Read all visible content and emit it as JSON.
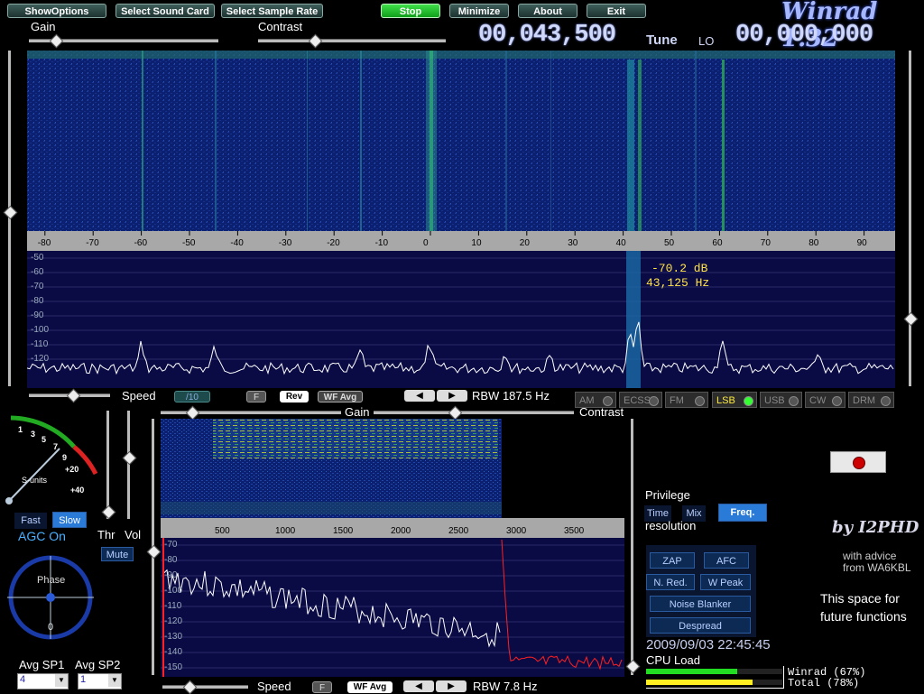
{
  "toolbar": {
    "show_options": "ShowOptions",
    "select_sound_card": "Select Sound Card",
    "select_sample_rate": "Select Sample Rate",
    "stop": "Stop",
    "minimize": "Minimize",
    "about": "About",
    "exit": "Exit"
  },
  "app_title": "Winrad 1.32",
  "top_sliders": {
    "gain": "Gain",
    "contrast": "Contrast"
  },
  "tune": {
    "label": "Tune",
    "value": "00,043,500",
    "lo_label": "LO",
    "lo_value": "00,000,000"
  },
  "main_spectrum": {
    "x_ticks": [
      "-80",
      "-70",
      "-60",
      "-50",
      "-40",
      "-30",
      "-20",
      "-10",
      "0",
      "10",
      "20",
      "30",
      "40",
      "50",
      "60",
      "70",
      "80",
      "90"
    ],
    "y_ticks": [
      "-50",
      "-60",
      "-70",
      "-80",
      "-90",
      "-100",
      "-110",
      "-120"
    ],
    "readout_db": "-70.2  dB",
    "readout_hz": "43,125  Hz"
  },
  "controls_row": {
    "speed_label": "Speed",
    "speed_value": "/10",
    "f_label": "F",
    "rev_label": "Rev",
    "wf_avg_label": "WF Avg",
    "rbw": "RBW  187.5 Hz"
  },
  "modes": [
    {
      "label": "AM",
      "active": false
    },
    {
      "label": "ECSS",
      "active": false
    },
    {
      "label": "FM",
      "active": false
    },
    {
      "label": "LSB",
      "active": true
    },
    {
      "label": "USB",
      "active": false
    },
    {
      "label": "CW",
      "active": false
    },
    {
      "label": "DRM",
      "active": false
    }
  ],
  "smeter": {
    "scale": [
      "1",
      "3",
      "5",
      "7",
      "9",
      "+20",
      "+40"
    ],
    "units_label": "S-units",
    "fast_label": "Fast",
    "slow_label": "Slow",
    "agc_label": "AGC On",
    "thr_label": "Thr",
    "vol_label": "Vol",
    "mute_label": "Mute"
  },
  "phase": {
    "label": "Phase",
    "zero": "0"
  },
  "averaging": {
    "sp1_label": "Avg SP1",
    "sp1_value": "4",
    "sp2_label": "Avg SP2",
    "sp2_value": "1"
  },
  "audio_panel": {
    "gain_label": "Gain",
    "contrast_label": "Contrast",
    "x_ticks": [
      "500",
      "1000",
      "1500",
      "2000",
      "2500",
      "3000",
      "3500"
    ],
    "y_ticks": [
      "-70",
      "-80",
      "-90",
      "-100",
      "-110",
      "-120",
      "-130",
      "-140",
      "-150"
    ],
    "speed_label": "Speed",
    "f_label": "F",
    "wf_avg_label": "WF Avg",
    "rbw": "RBW  7.8 Hz"
  },
  "privilege": {
    "title": "Privilege",
    "time": "Time",
    "mix": "Mix",
    "freq": "Freq.",
    "resolution": "resolution"
  },
  "dsp_buttons": {
    "zap": "ZAP",
    "afc": "AFC",
    "nred": "N. Red.",
    "wpeak": "W Peak",
    "noise_blanker": "Noise Blanker",
    "despread": "Despread"
  },
  "credits": {
    "by": "by I2PHD",
    "advice1": "with advice",
    "advice2": "from WA6KBL",
    "future1": "This space for",
    "future2": "future functions"
  },
  "status": {
    "datetime": "2009/09/03 22:45:45",
    "cpu_label": "CPU Load",
    "winrad_load": "Winrad (67%)",
    "winrad_pct": 67,
    "total_load": "Total  (78%)",
    "total_pct": 78
  },
  "colors": {
    "accent_green": "#22dd22",
    "lcd_blue": "#cfd8f8",
    "waterfall_bg": "#0a1a66",
    "trace": "#ffffff",
    "audio_trace_red": "#ff2020"
  }
}
